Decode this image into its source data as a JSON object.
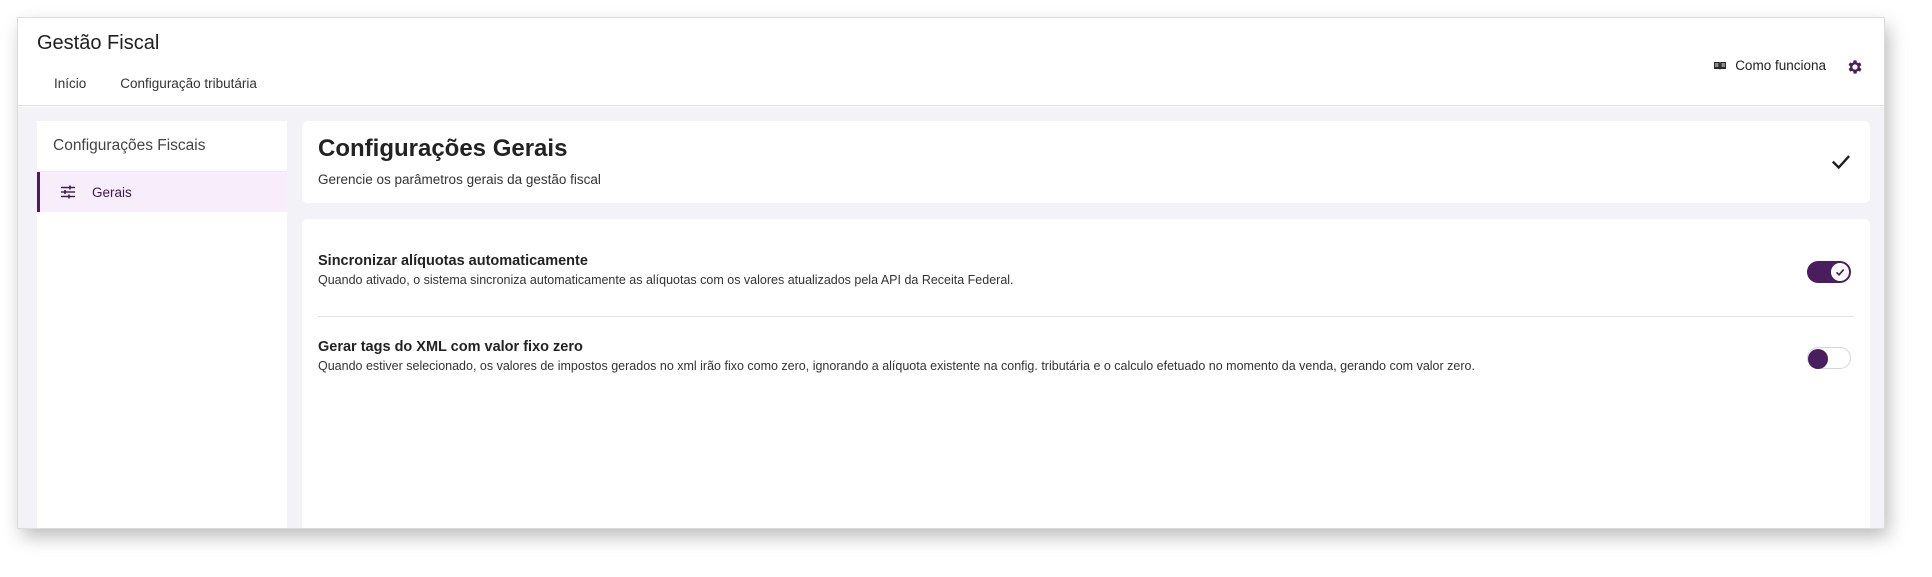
{
  "header": {
    "app_title": "Gestão Fiscal",
    "tabs": [
      {
        "label": "Início"
      },
      {
        "label": "Configuração tributária"
      }
    ],
    "help_label": "Como funciona"
  },
  "sidebar": {
    "title": "Configurações Fiscais",
    "items": [
      {
        "label": "Gerais",
        "icon": "sliders-icon",
        "active": true
      }
    ]
  },
  "main": {
    "title": "Configurações Gerais",
    "subtitle": "Gerencie os parâmetros gerais da gestão fiscal",
    "settings": [
      {
        "title": "Sincronizar alíquotas automaticamente",
        "description": "Quando ativado, o sistema sincroniza automaticamente as alíquotas com os valores atualizados pela API da Receita Federal.",
        "enabled": true
      },
      {
        "title": "Gerar tags do XML com valor fixo zero",
        "description": "Quando estiver selecionado, os valores de impostos gerados no xml irão fixo como zero, ignorando a alíquota existente na config. tributária e o calculo efetuado no momento da venda, gerando com valor zero.",
        "enabled": false
      }
    ]
  },
  "colors": {
    "accent": "#4a1d5e",
    "active_item_bg": "#f7edfb",
    "content_bg": "#f3f3f7"
  }
}
